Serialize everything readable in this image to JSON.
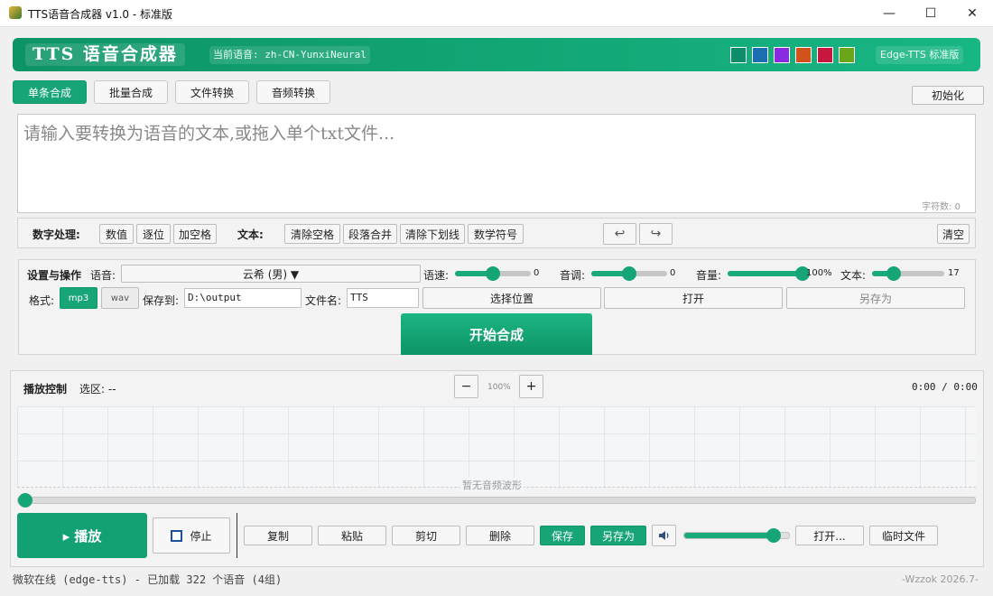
{
  "window": {
    "title": "TTS语音合成器 v1.0 - 标准版",
    "minimize": "—",
    "maximize": "☐",
    "close": "✕"
  },
  "header": {
    "app_name": "TTS 语音合成器",
    "current_voice": "当前语音: zh-CN-YunxiNeural",
    "version_badge": "Edge-TTS 标准版",
    "theme_swatches": [
      "#0f8c6a",
      "#1b6fb0",
      "#8a2be2",
      "#d2521c",
      "#c8173e",
      "#6aa51a"
    ]
  },
  "tabs": [
    "单条合成",
    "批量合成",
    "文件转换",
    "音频转换"
  ],
  "init_button": "初始化",
  "text_input": {
    "placeholder": "请输入要转换为语音的文本,或拖入单个txt文件...",
    "char_count": "字符数: 0"
  },
  "toolbar": {
    "number_label": "数字处理:",
    "number_buttons": [
      "数值",
      "逐位",
      "加空格"
    ],
    "text_label": "文本:",
    "text_buttons": [
      "清除空格",
      "段落合并",
      "清除下划线",
      "数学符号"
    ],
    "undo": "↩",
    "redo": "↪",
    "clear": "清空"
  },
  "settings": {
    "section_label": "设置与操作",
    "voice_label": "语音:",
    "voice_value": "云希 (男) ▼",
    "rate_label": "语速:",
    "rate_value": "0",
    "rate_fraction": 0.5,
    "pitch_label": "音调:",
    "pitch_value": "0",
    "pitch_fraction": 0.5,
    "volume_label": "音量:",
    "volume_value": "100%",
    "volume_fraction": 1.0,
    "text_size_label": "文本:",
    "text_size_value": "17",
    "text_size_fraction": 0.3,
    "format_label": "格式:",
    "format_options": [
      "mp3",
      "wav"
    ],
    "format_selected": "mp3",
    "save_to_label": "保存到:",
    "save_path": "D:\\output",
    "filename_label": "文件名:",
    "filename": "TTS",
    "choose_location": "选择位置",
    "open": "打开",
    "save_as": "另存为",
    "start": "开始合成"
  },
  "player": {
    "label": "播放控制",
    "selection": "选区: --",
    "zoom_out": "−",
    "zoom": "100%",
    "zoom_in": "+",
    "time": "0:00 / 0:00",
    "no_waveform": "暂无音频波形",
    "progress_fraction": 0,
    "play": "▸ 播放",
    "stop": "停止",
    "edit_buttons": [
      "复制",
      "粘贴",
      "剪切",
      "删除"
    ],
    "save": "保存",
    "save_as": "另存为",
    "volume_fraction": 0.85,
    "open": "打开...",
    "temp_files": "临时文件"
  },
  "status": {
    "left": "微软在线 (edge-tts) - 已加载 322 个语音 (4组)",
    "right": "-Wzzok 2026.7-"
  }
}
